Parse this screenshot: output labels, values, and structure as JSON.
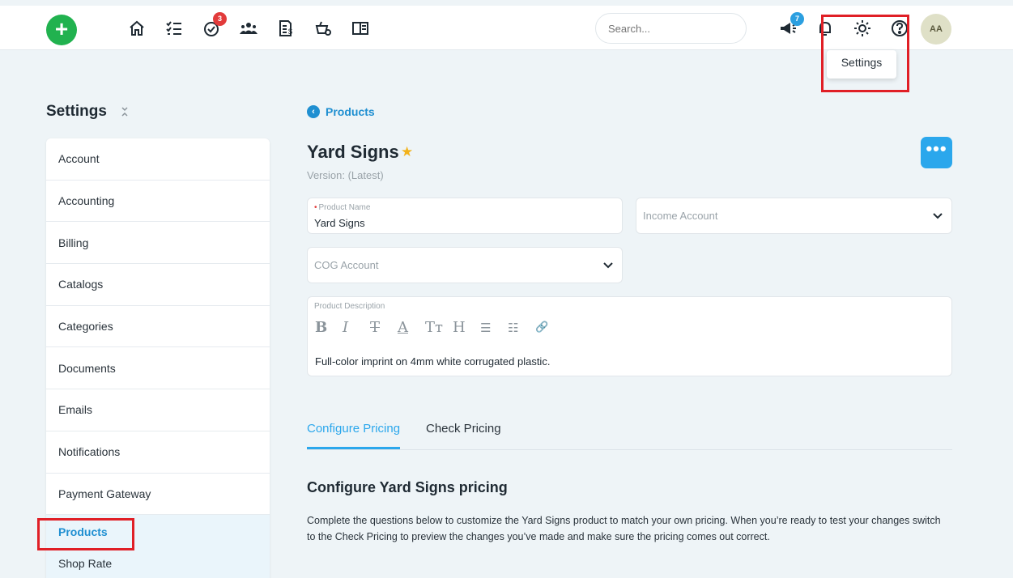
{
  "topbar": {
    "add_label": "+",
    "nav_icons": [
      "home-icon",
      "list-icon",
      "tasks-icon",
      "team-icon",
      "invoice-icon",
      "products-icon",
      "book-icon"
    ],
    "tasks_badge": "3",
    "search_placeholder": "Search...",
    "announce_badge": "7",
    "avatar_initials": "AA",
    "tooltip": "Settings"
  },
  "sidebar": {
    "title": "Settings",
    "items": [
      "Account",
      "Accounting",
      "Billing",
      "Catalogs",
      "Categories",
      "Documents",
      "Emails",
      "Notifications",
      "Payment Gateway",
      "Products",
      "Shop Rate"
    ],
    "active": "Products"
  },
  "main": {
    "breadcrumb": "Products",
    "title": "Yard Signs",
    "version": "Version: (Latest)",
    "more_label": "•••",
    "product_name": {
      "label": "Product Name",
      "value": "Yard Signs"
    },
    "income_account": {
      "placeholder": "Income Account"
    },
    "cog_account": {
      "placeholder": "COG Account"
    },
    "description": {
      "label": "Product Description",
      "toolbar": [
        "B",
        "I",
        "T",
        "A",
        "Tт",
        "H",
        "☰",
        "☷",
        "🔗"
      ],
      "text": "Full-color imprint on 4mm white corrugated plastic."
    },
    "tabs": [
      "Configure Pricing",
      "Check Pricing"
    ],
    "section_title": "Configure Yard Signs pricing",
    "section_desc": "Complete the questions below to customize the Yard Signs product to match your own pricing. When you’re ready to test your changes switch to the Check Pricing to preview the changes you’ve made and make sure the pricing comes out correct."
  },
  "colors": {
    "accent": "#2ba7ec",
    "add_green": "#21b24f",
    "highlight_red": "#e01f26"
  }
}
